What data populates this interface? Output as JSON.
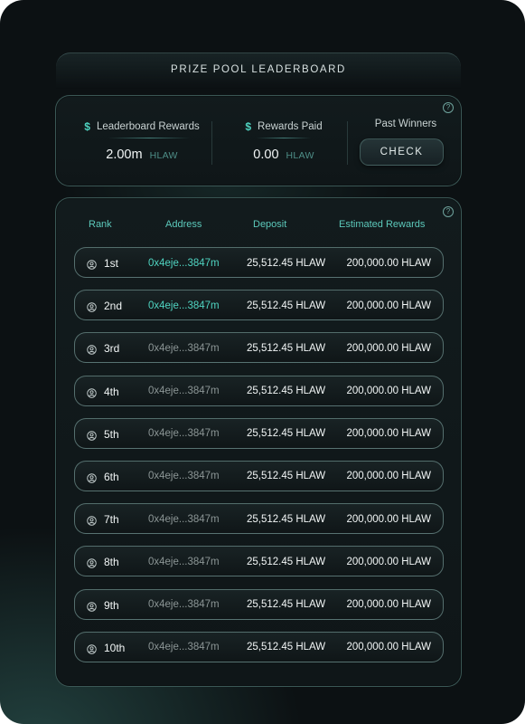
{
  "title": "PRIZE POOL LEADERBOARD",
  "stats": {
    "leaderboard_rewards": {
      "label": "Leaderboard Rewards",
      "value": "2.00m",
      "unit": "HLAW"
    },
    "rewards_paid": {
      "label": "Rewards Paid",
      "value": "0.00",
      "unit": "HLAW"
    },
    "past_winners": {
      "label": "Past Winners",
      "button": "CHECK"
    },
    "currency_symbol": "$",
    "help_symbol": "?"
  },
  "table": {
    "help_symbol": "?",
    "headers": {
      "rank": "Rank",
      "address": "Address",
      "deposit": "Deposit",
      "rewards": "Estimated Rewards"
    },
    "rows": [
      {
        "rank": "1st",
        "address": "0x4eje...3847m",
        "deposit": "25,512.45 HLAW",
        "reward": "200,000.00 HLAW",
        "highlight": true
      },
      {
        "rank": "2nd",
        "address": "0x4eje...3847m",
        "deposit": "25,512.45 HLAW",
        "reward": "200,000.00 HLAW",
        "highlight": true
      },
      {
        "rank": "3rd",
        "address": "0x4eje...3847m",
        "deposit": "25,512.45 HLAW",
        "reward": "200,000.00 HLAW",
        "highlight": false
      },
      {
        "rank": "4th",
        "address": "0x4eje...3847m",
        "deposit": "25,512.45 HLAW",
        "reward": "200,000.00 HLAW",
        "highlight": false
      },
      {
        "rank": "5th",
        "address": "0x4eje...3847m",
        "deposit": "25,512.45 HLAW",
        "reward": "200,000.00 HLAW",
        "highlight": false
      },
      {
        "rank": "6th",
        "address": "0x4eje...3847m",
        "deposit": "25,512.45 HLAW",
        "reward": "200,000.00 HLAW",
        "highlight": false
      },
      {
        "rank": "7th",
        "address": "0x4eje...3847m",
        "deposit": "25,512.45 HLAW",
        "reward": "200,000.00 HLAW",
        "highlight": false
      },
      {
        "rank": "8th",
        "address": "0x4eje...3847m",
        "deposit": "25,512.45 HLAW",
        "reward": "200,000.00 HLAW",
        "highlight": false
      },
      {
        "rank": "9th",
        "address": "0x4eje...3847m",
        "deposit": "25,512.45 HLAW",
        "reward": "200,000.00 HLAW",
        "highlight": false
      },
      {
        "rank": "10th",
        "address": "0x4eje...3847m",
        "deposit": "25,512.45 HLAW",
        "reward": "200,000.00 HLAW",
        "highlight": false
      }
    ]
  },
  "colors": {
    "accent": "#4fd4c1",
    "background": "#0c1113",
    "muted_text": "#8b9595"
  },
  "icons": {
    "currency": "dollar-icon",
    "help": "help-icon",
    "user": "user-icon"
  }
}
